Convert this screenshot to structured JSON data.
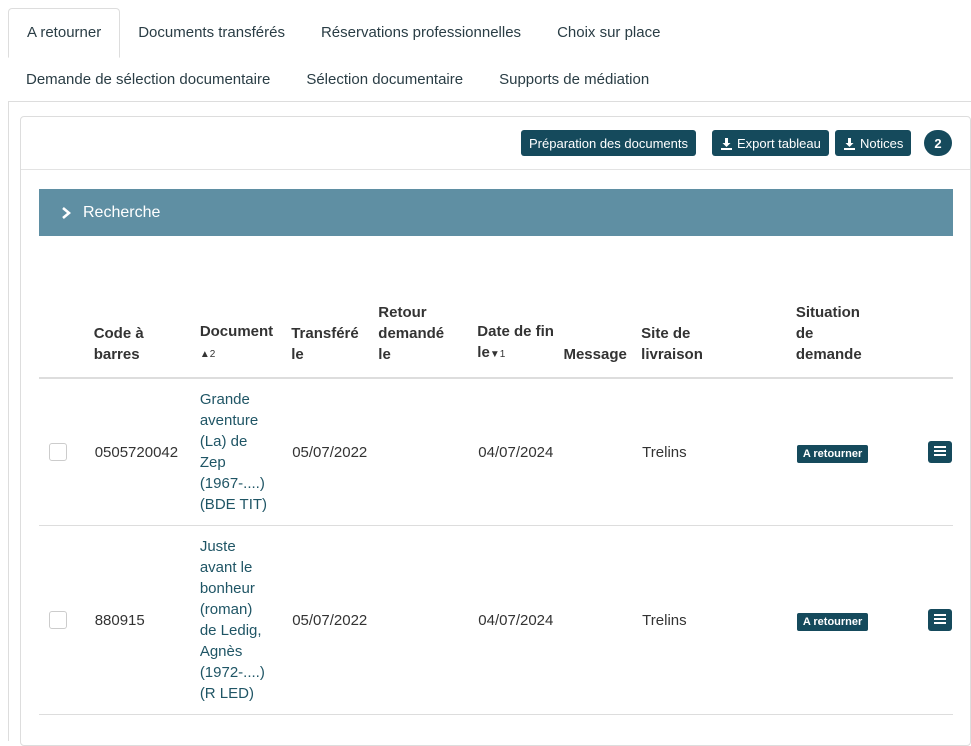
{
  "tabs_row1": [
    "A retourner",
    "Documents transférés",
    "Réservations professionnelles",
    "Choix sur place"
  ],
  "tabs_row2": [
    "Demande de sélection documentaire",
    "Sélection documentaire",
    "Supports de médiation"
  ],
  "active_tab": "A retourner",
  "toolbar": {
    "prep_label": "Préparation des documents",
    "export_label": "Export tableau",
    "notices_label": "Notices",
    "count": "2"
  },
  "search": {
    "label": "Recherche"
  },
  "table": {
    "headers": {
      "barcode": [
        "Code à",
        "barres"
      ],
      "document": "Document",
      "document_sort": "▲2",
      "transferred": [
        "Transféré",
        "le"
      ],
      "return_requested": [
        "Retour",
        "demandé",
        "le"
      ],
      "end_date": [
        "Date de fin",
        "le"
      ],
      "end_date_sort": "▼1",
      "message": "Message",
      "delivery_site": [
        "Site de",
        "livraison"
      ],
      "request_status": [
        "Situation",
        "de",
        "demande"
      ]
    },
    "rows": [
      {
        "barcode": "0505720042",
        "document_lines": [
          "Grande",
          "aventure",
          "(La) de",
          "Zep",
          "(1967-....)",
          "(BDE TIT)"
        ],
        "transferred": "05/07/2022",
        "return_requested": "",
        "end_date": "04/07/2024",
        "message": "",
        "delivery_site": "Trelins",
        "status": "A retourner"
      },
      {
        "barcode": "880915",
        "document_lines": [
          "Juste",
          "avant le",
          "bonheur",
          "(roman)",
          "de Ledig,",
          "Agnès",
          "(1972-....)",
          "(R LED)"
        ],
        "transferred": "05/07/2022",
        "return_requested": "",
        "end_date": "04/07/2024",
        "message": "",
        "delivery_site": "Trelins",
        "status": "A retourner"
      }
    ]
  },
  "colors": {
    "primary": "#154a5c",
    "search_bar": "#5f8fa3",
    "link_text": "#1f5565"
  }
}
